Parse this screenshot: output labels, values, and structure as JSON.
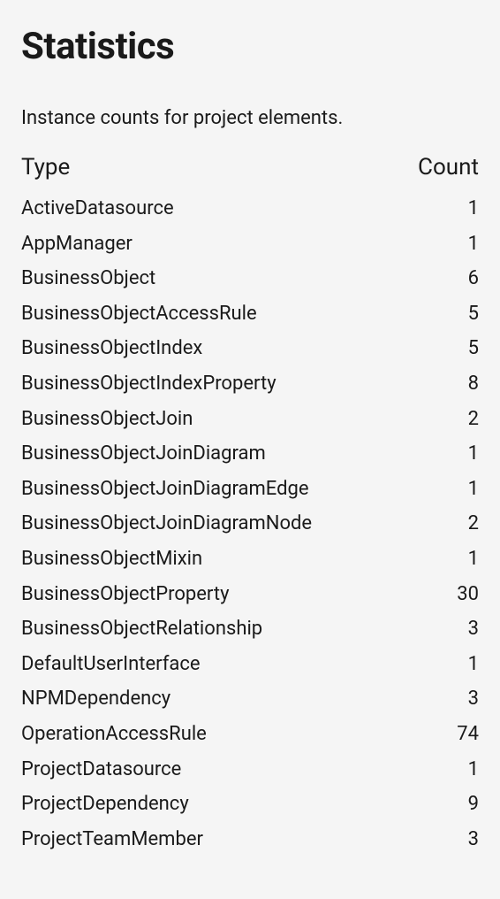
{
  "title": "Statistics",
  "subtitle": "Instance counts for project elements.",
  "table": {
    "headers": {
      "type": "Type",
      "count": "Count"
    },
    "rows": [
      {
        "type": "ActiveDatasource",
        "count": "1"
      },
      {
        "type": "AppManager",
        "count": "1"
      },
      {
        "type": "BusinessObject",
        "count": "6"
      },
      {
        "type": "BusinessObjectAccessRule",
        "count": "5"
      },
      {
        "type": "BusinessObjectIndex",
        "count": "5"
      },
      {
        "type": "BusinessObjectIndexProperty",
        "count": "8"
      },
      {
        "type": "BusinessObjectJoin",
        "count": "2"
      },
      {
        "type": "BusinessObjectJoinDiagram",
        "count": "1"
      },
      {
        "type": "BusinessObjectJoinDiagramEdge",
        "count": "1"
      },
      {
        "type": "BusinessObjectJoinDiagramNode",
        "count": "2"
      },
      {
        "type": "BusinessObjectMixin",
        "count": "1"
      },
      {
        "type": "BusinessObjectProperty",
        "count": "30"
      },
      {
        "type": "BusinessObjectRelationship",
        "count": "3"
      },
      {
        "type": "DefaultUserInterface",
        "count": "1"
      },
      {
        "type": "NPMDependency",
        "count": "3"
      },
      {
        "type": "OperationAccessRule",
        "count": "74"
      },
      {
        "type": "ProjectDatasource",
        "count": "1"
      },
      {
        "type": "ProjectDependency",
        "count": "9"
      },
      {
        "type": "ProjectTeamMember",
        "count": "3"
      }
    ]
  }
}
